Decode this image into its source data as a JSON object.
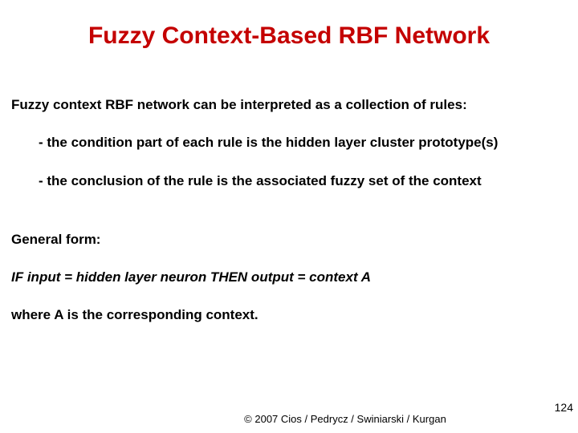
{
  "title": "Fuzzy Context-Based RBF Network",
  "intro": "Fuzzy context RBF network can be interpreted as a collection of rules:",
  "bullet1": "- the condition part of each rule is the hidden layer cluster prototype(s)",
  "bullet2": "- the conclusion of the rule is the associated fuzzy set of the context",
  "general_label": "General form:",
  "rule_text": "IF input =  hidden layer neuron THEN output = context A",
  "where_text": "where A is the corresponding context.",
  "copyright": "© 2007 Cios / Pedrycz / Swiniarski / Kurgan",
  "page_number": "124"
}
